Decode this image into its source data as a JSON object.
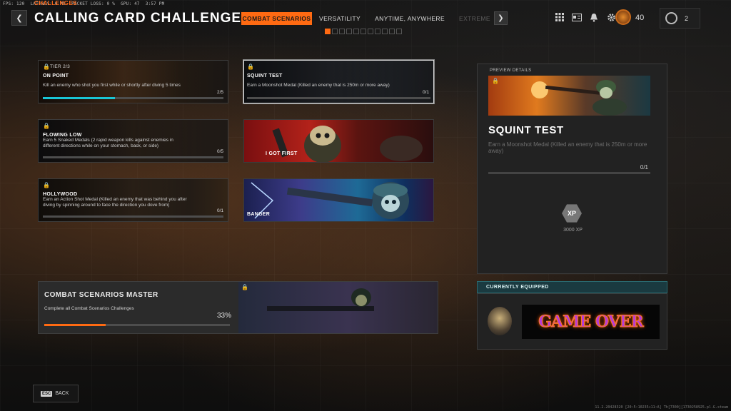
{
  "debug": {
    "fps": "FPS: 120",
    "latency": "LATENCY: 0 MS",
    "packet_loss": "PACKET LOSS: 0 %",
    "gpu": "GPU: 47",
    "time": "3:57 PM"
  },
  "header": {
    "breadcrumb": "CHALLENGES",
    "title": "CALLING CARD CHALLENGE",
    "tabs": [
      {
        "label": "COMBAT SCENARIOS",
        "active": true
      },
      {
        "label": "VERSATILITY",
        "active": false
      },
      {
        "label": "ANYTIME, ANYWHERE",
        "active": false
      },
      {
        "label": "EXTREME",
        "active": false
      }
    ],
    "page_count": 11,
    "page_active": 1,
    "rank_level": "40",
    "cp_count": "2",
    "icons": [
      "grid-menu-icon",
      "id-card-icon",
      "bell-icon",
      "gear-icon"
    ]
  },
  "cards": [
    {
      "tier": "TIER 2/3",
      "name": "ON POINT",
      "desc": "Kill an enemy who shot you first while or shortly after diving 5 times",
      "progress": "2/5",
      "fill": 0.4,
      "fill_color": "#19c6d6",
      "locked": true
    },
    {
      "tier": "",
      "name": "SQUINT TEST",
      "desc": "Earn a Moonshot Medal (Killed an enemy that is 250m or more away)",
      "progress": "0/1",
      "fill": 0,
      "fill_color": "#19c6d6",
      "locked": true,
      "selected": true
    },
    {
      "tier": "",
      "name": "FLOWING LOW",
      "desc": "Earn 5 Snaked Medals (2 rapid weapon kills against enemies in different directions while on your stomach, back, or side)",
      "progress": "0/5",
      "fill": 0,
      "fill_color": "#19c6d6",
      "locked": true
    },
    {
      "tier": "",
      "name": "I GOT FIRST",
      "desc": "",
      "progress": "",
      "fill": 0,
      "fill_color": "#19c6d6",
      "locked": false
    },
    {
      "tier": "",
      "name": "HOLLYWOOD",
      "desc": "Earn an Action Shot Medal (Killed an enemy that was behind you after diving by spinning around to face the direction you dove from)",
      "progress": "0/1",
      "fill": 0,
      "fill_color": "#19c6d6",
      "locked": true
    },
    {
      "tier": "",
      "name": "BANGER",
      "desc": "",
      "progress": "",
      "fill": 0,
      "fill_color": "#19c6d6",
      "locked": false
    }
  ],
  "master": {
    "title": "COMBAT SCENARIOS MASTER",
    "desc": "Complete all Combat Scenarios Challenges",
    "percent": "33%",
    "fill": 0.33,
    "fill_color": "#ff6a12"
  },
  "preview": {
    "label": "PREVIEW DETAILS",
    "title": "SQUINT TEST",
    "desc": "Earn a Moonshot Medal (Killed an enemy that is 250m or more away)",
    "progress": "0/1",
    "xp_icon_label": "XP",
    "xp_value": "3000 XP"
  },
  "equipped": {
    "header": "CURRENTLY EQUIPPED",
    "card_text": "GAME OVER"
  },
  "footer": {
    "esc_key": "ESC",
    "back_label": "BACK",
    "build": "11.2.20428320 [20:5:10235+11:A] Th[7300][1730258925.pl.G.steam"
  }
}
